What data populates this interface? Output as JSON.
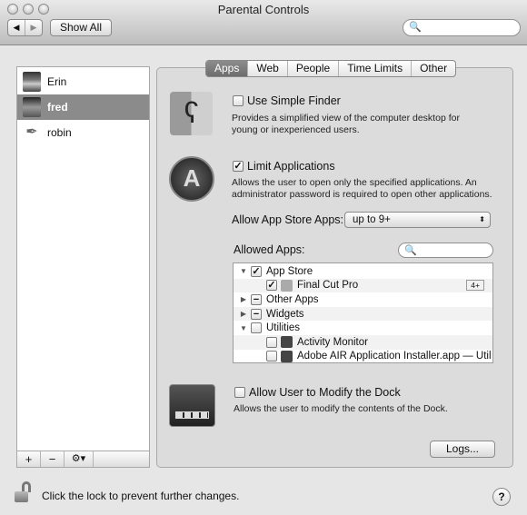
{
  "window": {
    "title": "Parental Controls"
  },
  "toolbar": {
    "back": "◀",
    "forward": "▶",
    "show_all": "Show All",
    "search_placeholder": ""
  },
  "sidebar": {
    "users": [
      {
        "name": "Erin"
      },
      {
        "name": "fred",
        "selected": true
      },
      {
        "name": "robin"
      }
    ],
    "add": "+",
    "remove": "−",
    "gear": "⚙▾"
  },
  "tabs": [
    {
      "label": "Apps",
      "active": true
    },
    {
      "label": "Web"
    },
    {
      "label": "People"
    },
    {
      "label": "Time Limits"
    },
    {
      "label": "Other"
    }
  ],
  "simple_finder": {
    "label": "Use Simple Finder",
    "checked": false,
    "desc1": "Provides a simplified view of the computer desktop for",
    "desc2": "young or inexperienced users."
  },
  "limit_apps": {
    "label": "Limit Applications",
    "checked": true,
    "desc1": "Allows the user to open only the specified applications. An",
    "desc2": "administrator password is required to open other applications."
  },
  "app_store": {
    "label": "Allow App Store Apps:",
    "value": "up to 9+"
  },
  "allowed_apps": {
    "label": "Allowed Apps:",
    "search_placeholder": "",
    "rows": [
      {
        "label": "App Store",
        "level": 0,
        "disclosure": "▼",
        "check": "✓"
      },
      {
        "label": "Final Cut Pro",
        "level": 1,
        "check": "✓",
        "badge": "4+"
      },
      {
        "label": "Other Apps",
        "level": 0,
        "disclosure": "▶",
        "check": "−"
      },
      {
        "label": "Widgets",
        "level": 0,
        "disclosure": "▶",
        "check": "−"
      },
      {
        "label": "Utilities",
        "level": 0,
        "disclosure": "▼",
        "check": ""
      },
      {
        "label": "Activity Monitor",
        "level": 1,
        "check": ""
      },
      {
        "label": "Adobe AIR Application Installer.app — Util",
        "level": 1,
        "check": ""
      }
    ]
  },
  "dock": {
    "label": "Allow User to Modify the Dock",
    "checked": false,
    "desc": "Allows the user to modify the contents of the Dock."
  },
  "logs": "Logs...",
  "footer": {
    "lock_text": "Click the lock to prevent further changes.",
    "help": "?"
  }
}
